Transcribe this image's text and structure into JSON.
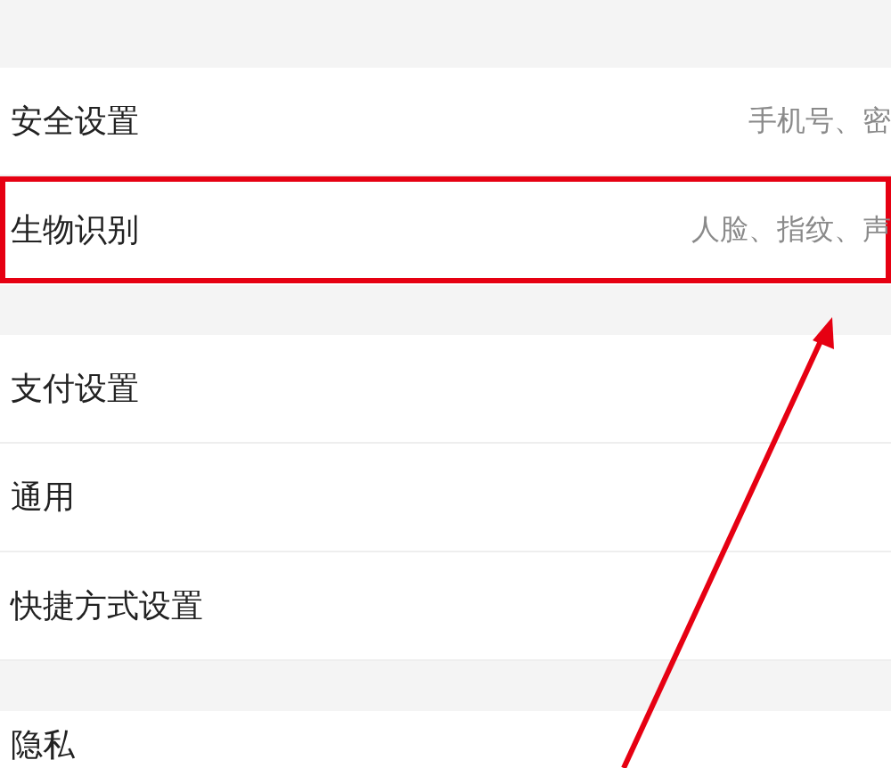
{
  "sections": [
    {
      "rows": [
        {
          "label": "安全设置",
          "detail": "手机号、密",
          "highlighted": false
        },
        {
          "label": "生物识别",
          "detail": "人脸、指纹、声",
          "highlighted": true
        }
      ]
    },
    {
      "rows": [
        {
          "label": "支付设置",
          "highlighted": false
        },
        {
          "label": "通用",
          "highlighted": false
        },
        {
          "label": "快捷方式设置",
          "highlighted": false
        }
      ]
    },
    {
      "rows": [
        {
          "label": "隐私",
          "highlighted": false
        }
      ]
    }
  ]
}
